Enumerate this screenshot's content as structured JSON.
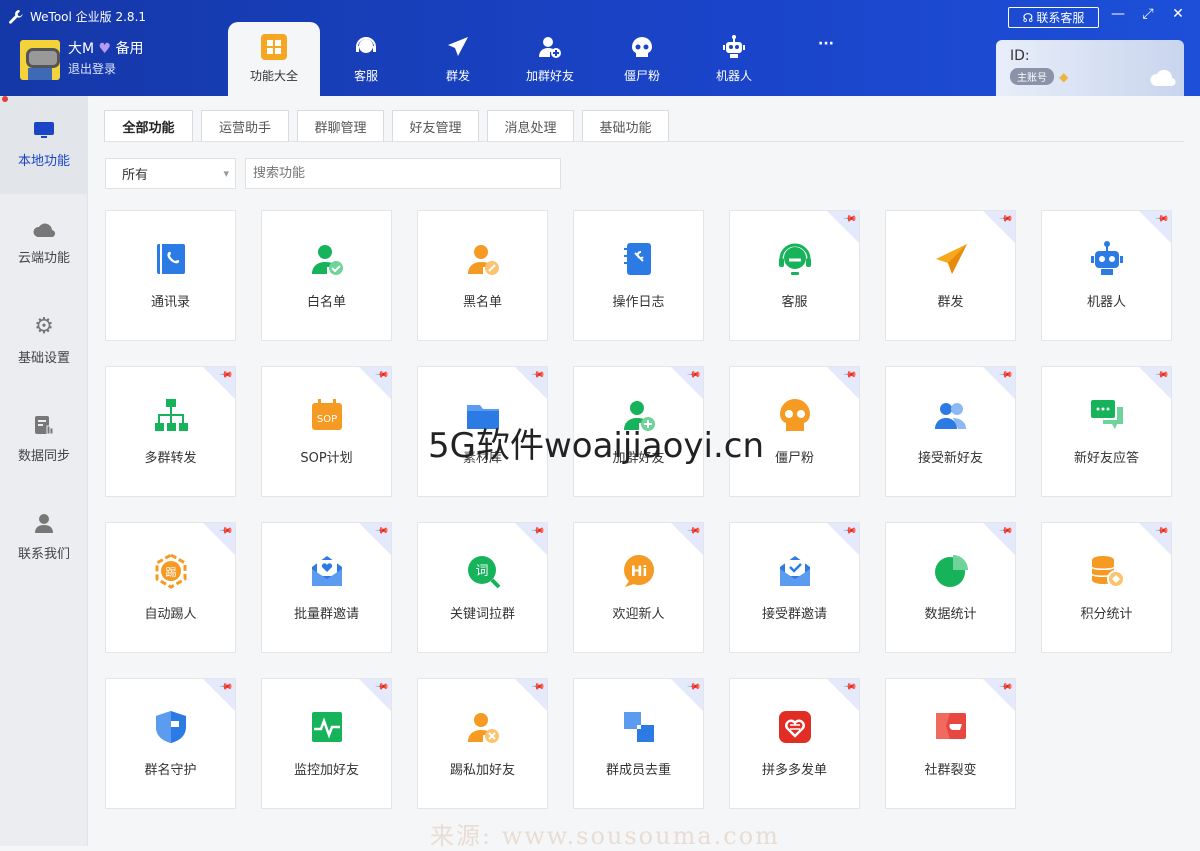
{
  "app": {
    "title": "WeTool 企业版 2.8.1",
    "service_label": "联系客服"
  },
  "user": {
    "name": "大M",
    "tag": "备用",
    "logout": "退出登录"
  },
  "nav": [
    {
      "label": "功能大全",
      "icon": "grid-icon"
    },
    {
      "label": "客服",
      "icon": "headset-icon"
    },
    {
      "label": "群发",
      "icon": "paper-plane-icon"
    },
    {
      "label": "加群好友",
      "icon": "add-user-icon"
    },
    {
      "label": "僵尸粉",
      "icon": "skull-icon"
    },
    {
      "label": "机器人",
      "icon": "robot-icon"
    },
    {
      "label": "···",
      "icon": "more-icon"
    }
  ],
  "account": {
    "id_label": "ID:",
    "badge": "主账号"
  },
  "sidebar": [
    {
      "label": "本地功能"
    },
    {
      "label": "云端功能"
    },
    {
      "label": "基础设置"
    },
    {
      "label": "数据同步"
    },
    {
      "label": "联系我们"
    }
  ],
  "tabs": [
    "全部功能",
    "运营助手",
    "群聊管理",
    "好友管理",
    "消息处理",
    "基础功能"
  ],
  "filter": {
    "selected": "所有",
    "search_placeholder": "搜索功能"
  },
  "features": [
    {
      "label": "通讯录",
      "icon": "contacts-icon",
      "pinned": false
    },
    {
      "label": "白名单",
      "icon": "whitelist-user-icon",
      "pinned": false
    },
    {
      "label": "黑名单",
      "icon": "blacklist-user-icon",
      "pinned": false
    },
    {
      "label": "操作日志",
      "icon": "log-book-icon",
      "pinned": false
    },
    {
      "label": "客服",
      "icon": "headset-icon",
      "pinned": true
    },
    {
      "label": "群发",
      "icon": "paper-plane-icon",
      "pinned": true
    },
    {
      "label": "机器人",
      "icon": "robot-icon",
      "pinned": true
    },
    {
      "label": "多群转发",
      "icon": "hierarchy-icon",
      "pinned": true
    },
    {
      "label": "SOP计划",
      "icon": "sop-calendar-icon",
      "pinned": true
    },
    {
      "label": "素材库",
      "icon": "folder-icon",
      "pinned": true
    },
    {
      "label": "加群好友",
      "icon": "add-user-icon",
      "pinned": true
    },
    {
      "label": "僵尸粉",
      "icon": "skull-icon",
      "pinned": true
    },
    {
      "label": "接受新好友",
      "icon": "users-icon",
      "pinned": true
    },
    {
      "label": "新好友应答",
      "icon": "chat-bubbles-icon",
      "pinned": true
    },
    {
      "label": "自动踢人",
      "icon": "kick-hexagon-icon",
      "pinned": true
    },
    {
      "label": "批量群邀请",
      "icon": "heart-envelope-icon",
      "pinned": true
    },
    {
      "label": "关键词拉群",
      "icon": "keyword-search-icon",
      "pinned": true
    },
    {
      "label": "欢迎新人",
      "icon": "hi-bubble-icon",
      "pinned": true
    },
    {
      "label": "接受群邀请",
      "icon": "check-envelope-icon",
      "pinned": true
    },
    {
      "label": "数据统计",
      "icon": "pie-chart-icon",
      "pinned": true
    },
    {
      "label": "积分统计",
      "icon": "coin-stack-icon",
      "pinned": true
    },
    {
      "label": "群名守护",
      "icon": "shield-icon",
      "pinned": true
    },
    {
      "label": "监控加好友",
      "icon": "pulse-monitor-icon",
      "pinned": true
    },
    {
      "label": "踢私加好友",
      "icon": "remove-user-icon",
      "pinned": true
    },
    {
      "label": "群成员去重",
      "icon": "dedupe-squares-icon",
      "pinned": true
    },
    {
      "label": "拼多多发单",
      "icon": "pinduoduo-icon",
      "pinned": true
    },
    {
      "label": "社群裂变",
      "icon": "fission-icon",
      "pinned": true
    }
  ],
  "watermarks": [
    "5G软件woaijiaoyi.cn",
    "来源: www.sousouma.com"
  ]
}
